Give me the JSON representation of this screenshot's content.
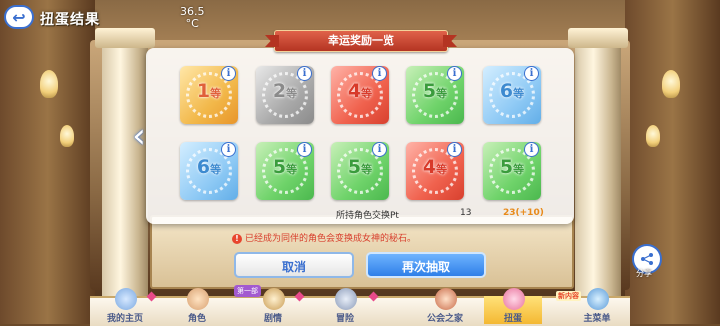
{
  "header": {
    "title": "扭蛋结果",
    "back_label": "↩",
    "temperature": "36.5",
    "temperature_unit": "°C"
  },
  "panel": {
    "title": "幸运奖励一览",
    "rewards": [
      {
        "rank": "1",
        "suffix": "等",
        "color": "gold"
      },
      {
        "rank": "2",
        "suffix": "等",
        "color": "silver"
      },
      {
        "rank": "4",
        "suffix": "等",
        "color": "red"
      },
      {
        "rank": "5",
        "suffix": "等",
        "color": "green"
      },
      {
        "rank": "6",
        "suffix": "等",
        "color": "blue"
      },
      {
        "rank": "6",
        "suffix": "等",
        "color": "blue"
      },
      {
        "rank": "5",
        "suffix": "等",
        "color": "green"
      },
      {
        "rank": "5",
        "suffix": "等",
        "color": "green"
      },
      {
        "rank": "4",
        "suffix": "等",
        "color": "red"
      },
      {
        "rank": "5",
        "suffix": "等",
        "color": "green"
      }
    ],
    "info_symbol": "i",
    "pt_label": "所持角色交换Pt",
    "pt_before": "13",
    "pt_after": "23(+10)"
  },
  "notice": {
    "symbol": "!",
    "text": "已经成为同伴的角色会变换成女神的秘石。"
  },
  "buttons": {
    "cancel": "取消",
    "draw_again": "再次抽取",
    "left_arrow": "‹"
  },
  "share": {
    "label": "分享"
  },
  "nav": {
    "items": [
      {
        "label": "我的主页"
      },
      {
        "label": "角色"
      },
      {
        "label": "剧情"
      },
      {
        "label": "冒险"
      },
      {
        "label": "公会之家"
      },
      {
        "label": "扭蛋"
      },
      {
        "label": "主菜单"
      }
    ],
    "story_badge": "第一部",
    "new_badge": "新内容"
  },
  "colors": {
    "accent": "#3a6fcf",
    "draw_button": "#2f7fe8",
    "notice": "#d8402e",
    "pt_gain": "#e88a1a"
  }
}
